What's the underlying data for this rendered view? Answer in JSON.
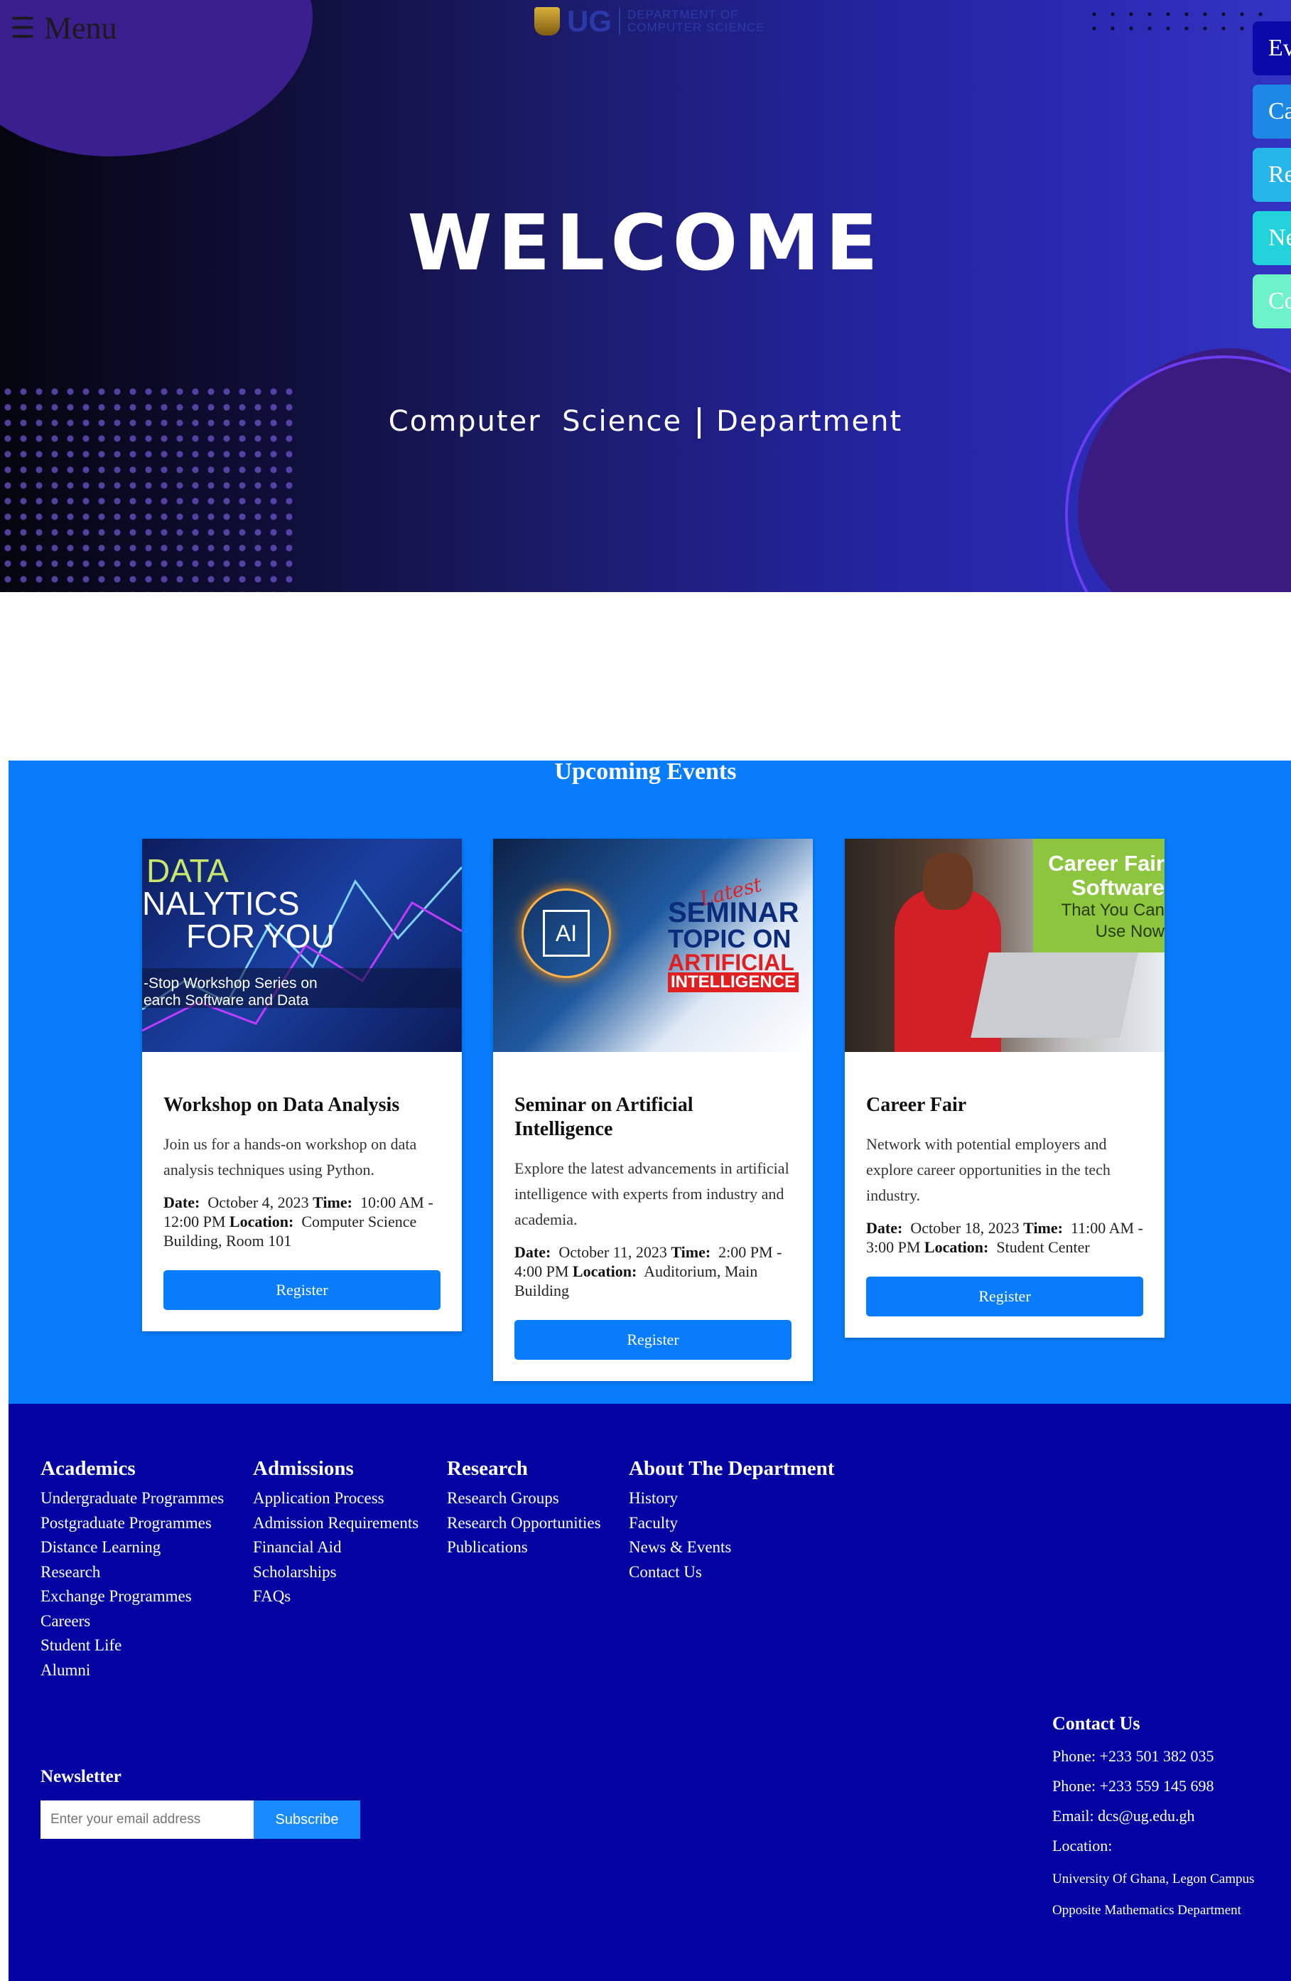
{
  "header": {
    "menu_icon": "☰",
    "menu_label": "Menu",
    "logo_text": "UG",
    "logo_dept_line1": "DEPARTMENT OF",
    "logo_dept_line2": "COMPUTER SCIENCE"
  },
  "hero": {
    "title": "WELCOME",
    "subtitle_left": "Computer  Science",
    "subtitle_right": "Department"
  },
  "side_tabs": [
    {
      "label": "Ev",
      "color": "#0a0aa8"
    },
    {
      "label": "Ca",
      "color": "#1e88e5"
    },
    {
      "label": "Re",
      "color": "#26b5e8"
    },
    {
      "label": "Ne",
      "color": "#22d3dc"
    },
    {
      "label": "Co",
      "color": "#6ef2c8"
    }
  ],
  "events": {
    "heading": "Upcoming Events",
    "cards": [
      {
        "image_lines": [
          "DATA",
          "NALYTICS",
          "FOR YOU"
        ],
        "image_caption": "-Stop Workshop Series on\nearch Software and Data",
        "title": "Workshop on Data Analysis",
        "description": "Join us for a hands-on workshop on data analysis techniques using Python.",
        "date_label": "Date:",
        "date": "October 4, 2023",
        "time_label": "Time:",
        "time": "10:00 AM - 12:00 PM",
        "location_label": "Location:",
        "location": "Computer Science Building, Room 101",
        "button": "Register"
      },
      {
        "image_lines": [
          "Latest",
          "SEMINAR",
          "TOPIC ON",
          "ARTIFICIAL",
          "INTELLIGENCE"
        ],
        "image_caption": "AI",
        "title": "Seminar on Artificial Intelligence",
        "description": "Explore the latest advancements in artificial intelligence with experts from industry and academia.",
        "date_label": "Date:",
        "date": "October 11, 2023",
        "time_label": "Time:",
        "time": "2:00 PM - 4:00 PM",
        "location_label": "Location:",
        "location": "Auditorium, Main Building",
        "button": "Register"
      },
      {
        "image_lines": [
          "Career Fair",
          "Software",
          "That You Can",
          "Use Now"
        ],
        "image_caption": "",
        "title": "Career Fair",
        "description": "Network with potential employers and explore career opportunities in the tech industry.",
        "date_label": "Date:",
        "date": "October 18, 2023",
        "time_label": "Time:",
        "time": "11:00 AM - 3:00 PM",
        "location_label": "Location:",
        "location": "Student Center",
        "button": "Register"
      }
    ]
  },
  "footer": {
    "columns": [
      {
        "title": "Academics",
        "links": [
          "Undergraduate Programmes",
          "Postgraduate Programmes",
          "Distance Learning",
          "Research",
          "Exchange Programmes",
          "Careers",
          "Student Life",
          "Alumni"
        ]
      },
      {
        "title": "Admissions",
        "links": [
          "Application Process",
          "Admission Requirements",
          "Financial Aid",
          "Scholarships",
          "FAQs"
        ]
      },
      {
        "title": "Research",
        "links": [
          "Research Groups",
          "Research Opportunities",
          "Publications"
        ]
      },
      {
        "title": "About The Department",
        "links": [
          "History",
          "Faculty",
          "News & Events",
          "Contact Us"
        ]
      }
    ],
    "newsletter": {
      "title": "Newsletter",
      "placeholder": "Enter your email address",
      "button": "Subscribe"
    },
    "contact": {
      "title": "Contact Us",
      "phone1": "Phone: +233 501 382 035",
      "phone2": "Phone: +233 559 145 698",
      "email": "Email: dcs@ug.edu.gh",
      "location_label": "Location:",
      "address1": "University Of Ghana, Legon Campus",
      "address2": "Opposite Mathematics Department"
    }
  }
}
